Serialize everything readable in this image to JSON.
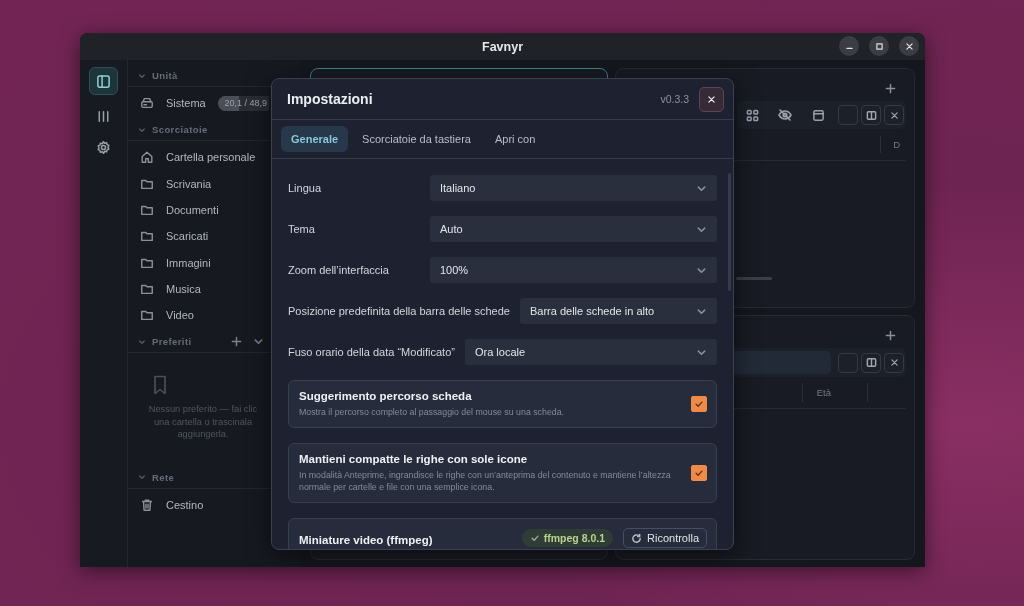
{
  "window": {
    "title": "Favnyr"
  },
  "rail": [
    {
      "kind": "sidebar",
      "selected": true
    },
    {
      "kind": "columns",
      "selected": false
    },
    {
      "kind": "settings",
      "selected": false
    }
  ],
  "sidebar": {
    "sections": [
      {
        "title": "Unità",
        "kind": "plain",
        "items": [
          {
            "kind": "drive",
            "label": "Sistema",
            "usage": {
              "text": "20,1 / 48,9",
              "level": 0.41
            }
          }
        ]
      },
      {
        "title": "Scorciatoie",
        "kind": "plain",
        "items": [
          {
            "kind": "home",
            "label": "Cartella personale"
          },
          {
            "kind": "folder",
            "label": "Scrivania"
          },
          {
            "kind": "folder",
            "label": "Documenti"
          },
          {
            "kind": "folder",
            "label": "Scaricati"
          },
          {
            "kind": "folder",
            "label": "Immagini"
          },
          {
            "kind": "folder",
            "label": "Musica"
          },
          {
            "kind": "folder",
            "label": "Video"
          }
        ]
      },
      {
        "title": "Preferiti",
        "kind": "favorites",
        "empty_hint_lines": [
          "Nessun preferito — fai clic",
          "una cartella o trascinala",
          "aggiungerla."
        ]
      },
      {
        "title": "Rete",
        "kind": "plain",
        "items": [
          {
            "kind": "trash",
            "label": "Cestino"
          }
        ]
      }
    ]
  },
  "panes": [
    {
      "focused": true,
      "kind": "blank"
    },
    {
      "focused": false,
      "kind": "icons",
      "column_header": "D"
    },
    {
      "focused": false,
      "kind": "search",
      "column_header": "Età"
    }
  ],
  "dialog": {
    "title": "Impostazioni",
    "version": "v0.3.3",
    "tabs": [
      {
        "label": "Generale",
        "selected": true
      },
      {
        "label": "Scorciatoie da tastiera",
        "selected": false
      },
      {
        "label": "Apri con",
        "selected": false
      }
    ],
    "settings": [
      {
        "label": "Lingua",
        "value": "Italiano"
      },
      {
        "label": "Tema",
        "value": "Auto"
      },
      {
        "label": "Zoom dell’interfaccia",
        "value": "100%"
      },
      {
        "label": "Posizione predefinita della barra delle schede",
        "value": "Barra delle schede in alto"
      },
      {
        "label": "Fuso orario della data “Modificato”",
        "value": "Ora locale"
      }
    ],
    "options": [
      {
        "title": "Suggerimento percorso scheda",
        "description": "Mostra il percorso completo al passaggio del mouse su una scheda.",
        "checked": true
      },
      {
        "title": "Mantieni compatte le righe con sole icone",
        "description": "In modalità Anteprime, ingrandisce le righe con un’anteprima del contenuto e mantiene l’altezza normale per cartelle e file con una semplice icona.",
        "checked": true
      }
    ],
    "ffmpeg": {
      "title": "Miniature video (ffmpeg)",
      "status": "ffmpeg 8.0.1",
      "button": "Ricontrolla"
    }
  }
}
